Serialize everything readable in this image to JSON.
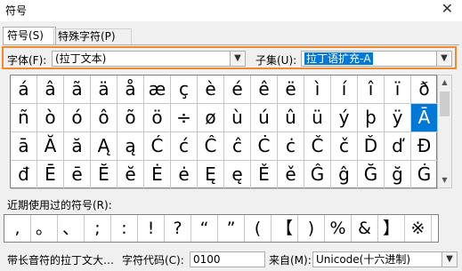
{
  "window": {
    "title": "符号",
    "close_glyph": "✕"
  },
  "tabs": [
    {
      "label": "符号(S)"
    },
    {
      "label": "特殊字符(P)"
    }
  ],
  "font": {
    "label": "字体(F):",
    "value": "(拉丁文本)"
  },
  "subset": {
    "label": "子集(U):",
    "value": "拉丁语扩充-A"
  },
  "grid": {
    "rows": [
      [
        "á",
        "â",
        "ã",
        "ä",
        "å",
        "æ",
        "ç",
        "è",
        "é",
        "ê",
        "ë",
        "ì",
        "í",
        "î",
        "ï",
        "ð"
      ],
      [
        "ñ",
        "ò",
        "ó",
        "ô",
        "õ",
        "ö",
        "÷",
        "ø",
        "ù",
        "ú",
        "û",
        "ü",
        "ý",
        "þ",
        "ÿ",
        "Ā"
      ],
      [
        "ā",
        "Ă",
        "ă",
        "Ą",
        "ą",
        "Ć",
        "ć",
        "Ĉ",
        "ĉ",
        "Ċ",
        "ċ",
        "Č",
        "č",
        "Ď",
        "ď",
        "Đ"
      ],
      [
        "đ",
        "Ē",
        "ē",
        "Ĕ",
        "ĕ",
        "Ė",
        "ė",
        "Ę",
        "ę",
        "Ě",
        "ě",
        "Ĝ",
        "ĝ",
        "Ğ",
        "ğ",
        "Ġ"
      ]
    ],
    "selected": "Ā"
  },
  "recent": {
    "label": "近期使用过的符号(R):",
    "symbols": [
      ",",
      "。",
      "、",
      ";",
      ":",
      "!",
      "?",
      "“",
      "”",
      "(",
      "【",
      ")",
      "%",
      "&",
      "】",
      "※"
    ]
  },
  "bottom": {
    "char_name": "带长音符的拉丁文大…",
    "code_label": "字符代码(C):",
    "code_value": "0100",
    "from_label": "来自(M):",
    "from_value": "Unicode(十六进制)"
  },
  "colors": {
    "highlight_border": "#ef8a2e",
    "selection": "#0078d7"
  }
}
